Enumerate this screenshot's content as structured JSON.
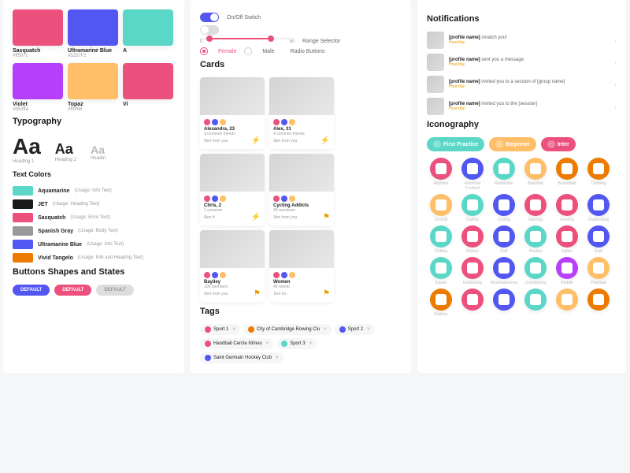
{
  "colors": {
    "sasquatch": {
      "name": "Sasquatch",
      "hex": "#ff507c",
      "val": "#ec507c"
    },
    "ultramarine": {
      "name": "Ultramarine Blue",
      "hex": "#5257F2",
      "val": "#5257f2"
    },
    "aq": {
      "name": "A",
      "hex": "",
      "val": "#5ad7c6"
    },
    "violet": {
      "name": "Violet",
      "hex": "#b53ffa",
      "val": "#b53ffa"
    },
    "topaz": {
      "name": "Topaz",
      "hex": "#ffbf68",
      "val": "#ffbf68"
    },
    "vi": {
      "name": "Vi",
      "hex": "",
      "val": "#ec507c"
    }
  },
  "typography": {
    "title": "Typography",
    "heading1": "Heading 1",
    "heading2": "Heading 2",
    "heading3": "Headin",
    "sample": "Aa"
  },
  "textColors": {
    "title": "Text Colors",
    "items": [
      {
        "name": "Aquamarine",
        "usage": "(Usage: Info Text)",
        "c": "#5ad7c6"
      },
      {
        "name": "JET",
        "usage": "(Usage: Heading Text)",
        "c": "#1a1a1a"
      },
      {
        "name": "Sasquatch",
        "usage": "(Usage: Error Text)",
        "c": "#ec507c"
      },
      {
        "name": "Spanish Gray",
        "usage": "(Usage: Body Text)",
        "c": "#999"
      },
      {
        "name": "Ultramarine Blue",
        "usage": "(Usage: Info Text)",
        "c": "#5257f2"
      },
      {
        "name": "Vivid Tangelo",
        "usage": "(Usage: Info and Heading Text)",
        "c": "#ec7b00"
      }
    ]
  },
  "buttons": {
    "title": "Buttons Shapes and States",
    "label": "DEFAULT"
  },
  "controls": {
    "switch": "On/Off Switch",
    "range": "Range Selector",
    "rangeMin": "0",
    "rangeMax": "50",
    "radio": "Radio Buttons",
    "female": "Female",
    "male": "Male"
  },
  "cards": {
    "title": "Cards",
    "items": [
      {
        "name": "Alexandra, 23",
        "friends": "3 common friends",
        "dist": "5km from you"
      },
      {
        "name": "Alex, 31",
        "friends": "4 common friends",
        "dist": "3km from you"
      },
      {
        "name": "Chris, 2",
        "friends": "1 common",
        "dist": "6km fr"
      },
      {
        "name": "Cycling Addicts",
        "friends": "30 members",
        "dist": "3km from you"
      },
      {
        "name": "Baylley",
        "friends": "100 members",
        "dist": "5km from you"
      },
      {
        "name": "Women",
        "friends": "45 memb",
        "dist": "1km fro"
      }
    ]
  },
  "tags": {
    "title": "Tags",
    "items": [
      {
        "label": "Sport 1",
        "c": "#ec507c"
      },
      {
        "label": "City of Cambridge Rowing Clu",
        "c": "#ec7b00"
      },
      {
        "label": "Sport 2",
        "c": "#5257f2"
      },
      {
        "label": "Handball Cercle Nîmes",
        "c": "#ec507c"
      },
      {
        "label": "Sport 3",
        "c": "#5ad7c6"
      },
      {
        "label": "Saint Germain Hockey Club",
        "c": "#5257f2"
      }
    ]
  },
  "notifications": {
    "title": "Notifications",
    "items": [
      {
        "text": "[profile name]",
        "action": " smatch you!",
        "time": "Hour/day"
      },
      {
        "text": "[profile name]",
        "action": " sent you a message",
        "time": "Hour/day"
      },
      {
        "text": "[profile name]",
        "action": " invited you to a session of [group name]",
        "time": "Hour/day"
      },
      {
        "text": "[profile name]",
        "action": " invited you to the [session]",
        "time": "Hour/day"
      }
    ]
  },
  "iconography": {
    "title": "Iconography",
    "pills": [
      {
        "label": "First Practice",
        "c": "#5ad7c6"
      },
      {
        "label": "Beginner",
        "c": "#ffbf68"
      },
      {
        "label": "Inter",
        "c": "#ec507c"
      }
    ],
    "icons": [
      {
        "label": "Alpinism",
        "c": "#ec507c"
      },
      {
        "label": "American Football",
        "c": "#5257f2"
      },
      {
        "label": "Badminton",
        "c": "#5ad7c6"
      },
      {
        "label": "Baseball",
        "c": "#ffbf68"
      },
      {
        "label": "Basketball",
        "c": "#ec7b00"
      },
      {
        "label": "Climbing",
        "c": "#ec7b00"
      },
      {
        "label": "Crossfit",
        "c": "#ffbf68"
      },
      {
        "label": "Curling",
        "c": "#5ad7c6"
      },
      {
        "label": "Cycling",
        "c": "#5257f2"
      },
      {
        "label": "Dancing",
        "c": "#ec507c"
      },
      {
        "label": "Fencing",
        "c": "#ec507c"
      },
      {
        "label": "Flagfootball",
        "c": "#5257f2"
      },
      {
        "label": "Fishing",
        "c": "#5ad7c6"
      },
      {
        "label": "Fitness",
        "c": "#ec507c"
      },
      {
        "label": "Golf",
        "c": "#5257f2"
      },
      {
        "label": "Hockey",
        "c": "#5ad7c6"
      },
      {
        "label": "Jujitsu",
        "c": "#ec507c"
      },
      {
        "label": "Judo",
        "c": "#5257f2"
      },
      {
        "label": "Karate",
        "c": "#5ad7c6"
      },
      {
        "label": "Kickboxing",
        "c": "#ec507c"
      },
      {
        "label": "Mountaineering",
        "c": "#5257f2"
      },
      {
        "label": "Orienteering",
        "c": "#5ad7c6"
      },
      {
        "label": "Paddle",
        "c": "#b53ffa"
      },
      {
        "label": "Paintball",
        "c": "#ffbf68"
      },
      {
        "label": "Parkour",
        "c": "#ec7b00"
      },
      {
        "label": "",
        "c": "#ec507c"
      },
      {
        "label": "",
        "c": "#5257f2"
      },
      {
        "label": "",
        "c": "#5ad7c6"
      },
      {
        "label": "",
        "c": "#ffbf68"
      },
      {
        "label": "",
        "c": "#ec7b00"
      }
    ]
  }
}
